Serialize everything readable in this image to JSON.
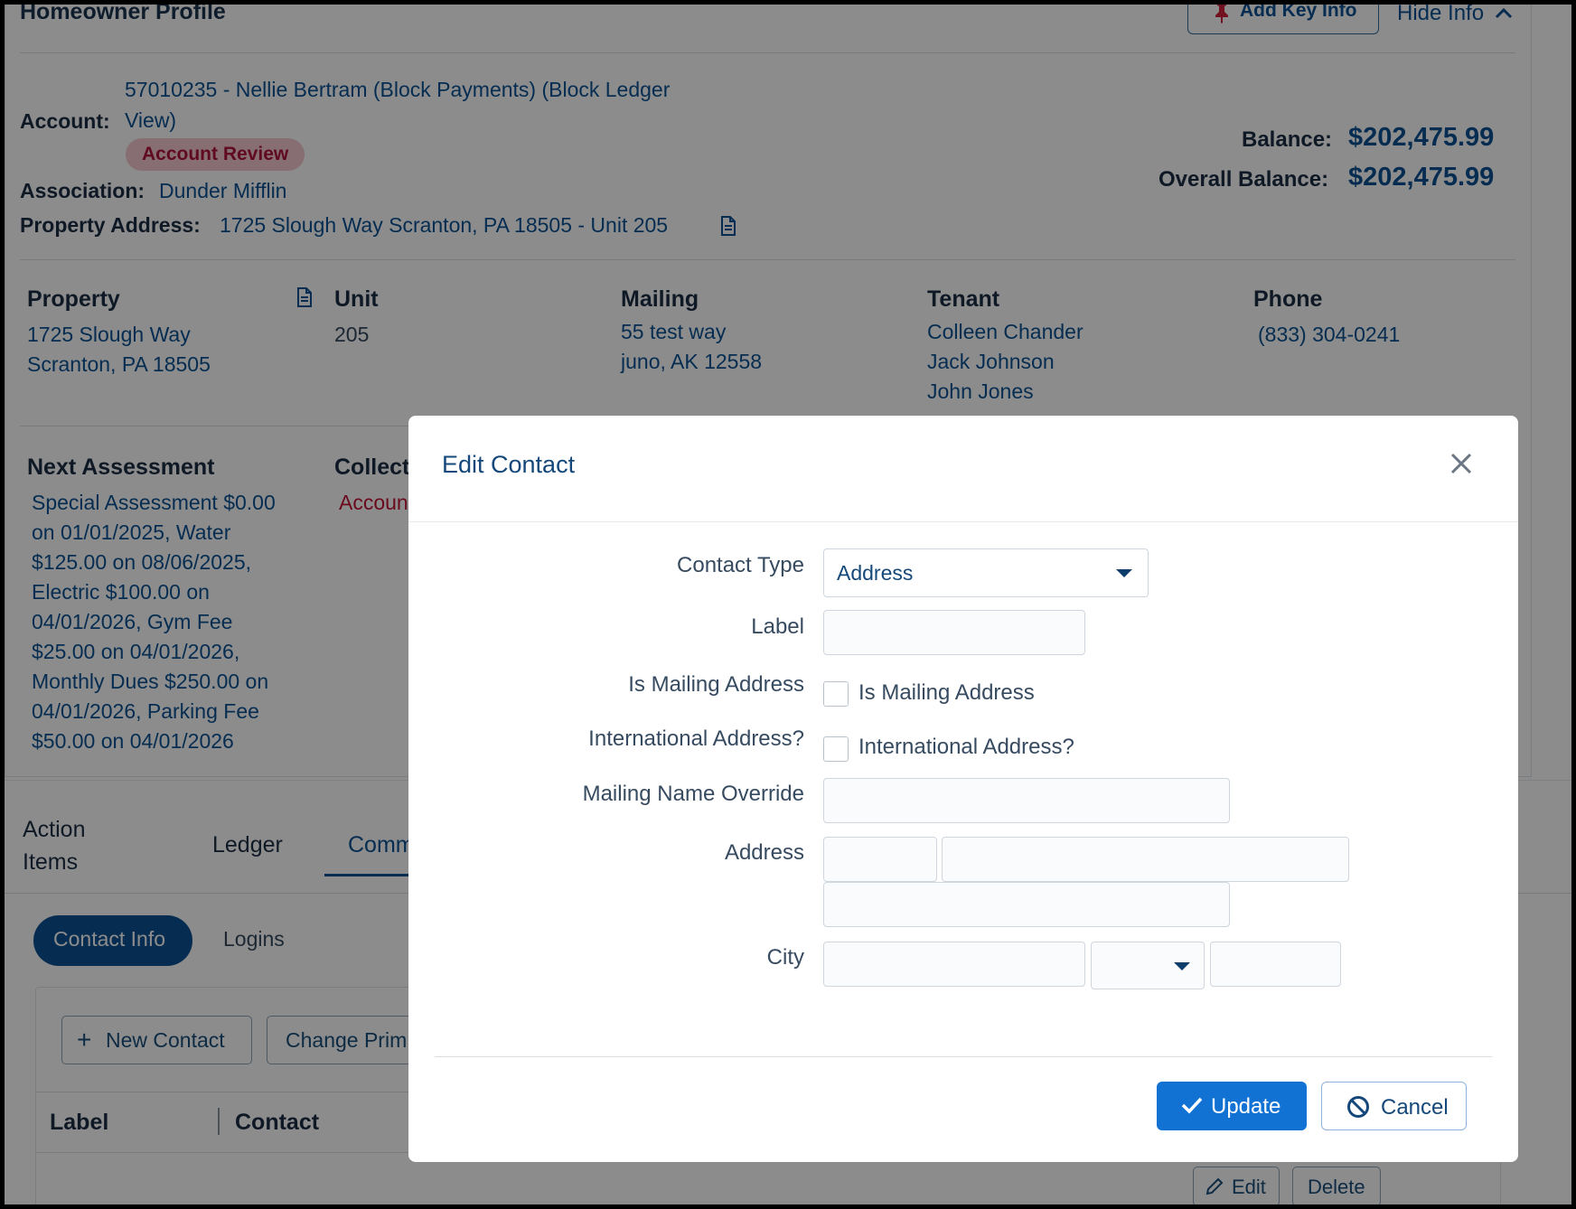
{
  "profile": {
    "title": "Homeowner Profile",
    "add_key_info": "Add Key Info",
    "hide_info": "Hide Info",
    "account_label": "Account:",
    "account_value_line1": "57010235 - Nellie Bertram (Block Payments) (Block Ledger",
    "account_value_line2": "View)",
    "account_badge": "Account Review",
    "association_label": "Association:",
    "association_value": "Dunder Mifflin",
    "property_address_label": "Property Address:",
    "property_address_value": "1725 Slough Way Scranton, PA 18505 - Unit 205",
    "balance_label": "Balance:",
    "balance_value": "$202,475.99",
    "overall_balance_label": "Overall Balance:",
    "overall_balance_value": "$202,475.99"
  },
  "details": {
    "property_h": "Property",
    "property_v": "1725 Slough Way\nScranton, PA 18505",
    "unit_h": "Unit",
    "unit_v": "205",
    "mailing_h": "Mailing",
    "mailing_v": "55 test way\njuno, AK 12558",
    "tenant_h": "Tenant",
    "tenant_v": "Colleen Chander\nJack Johnson\nJohn Jones",
    "phone_h": "Phone",
    "phone_v": "(833) 304-0241",
    "next_assessment_h": "Next Assessment",
    "next_assessment_v": "Special Assessment $0.00\non 01/01/2025, Water\n$125.00 on 08/06/2025,\nElectric $100.00 on\n04/01/2026, Gym Fee\n$25.00 on 04/01/2026,\nMonthly Dues $250.00 on\n04/01/2026, Parking Fee\n$50.00 on 04/01/2026",
    "collections_h": "Collect",
    "collections_v": "Accoun"
  },
  "tabs": {
    "action_items": "Action\nItems",
    "ledger": "Ledger",
    "comm": "Comm"
  },
  "subtabs": {
    "contact_info": "Contact Info",
    "logins": "Logins"
  },
  "toolbar": {
    "new_contact": "New Contact",
    "change_primary": "Change Prim"
  },
  "table": {
    "col_label": "Label",
    "col_contact": "Contact",
    "edit": "Edit",
    "delete": "Delete"
  },
  "modal": {
    "title": "Edit Contact",
    "contact_type_label": "Contact Type",
    "contact_type_value": "Address",
    "label_label": "Label",
    "is_mailing_label": "Is Mailing Address",
    "is_mailing_checkbox": "Is Mailing Address",
    "international_label": "International Address?",
    "international_checkbox": "International Address?",
    "mailing_name_label": "Mailing Name Override",
    "address_label": "Address",
    "city_label": "City",
    "update": "Update",
    "cancel": "Cancel"
  },
  "colors": {
    "accent": "#1172d4",
    "link": "#0b5394",
    "badge_bg": "#f6c9d2",
    "badge_text": "#b0133d"
  }
}
